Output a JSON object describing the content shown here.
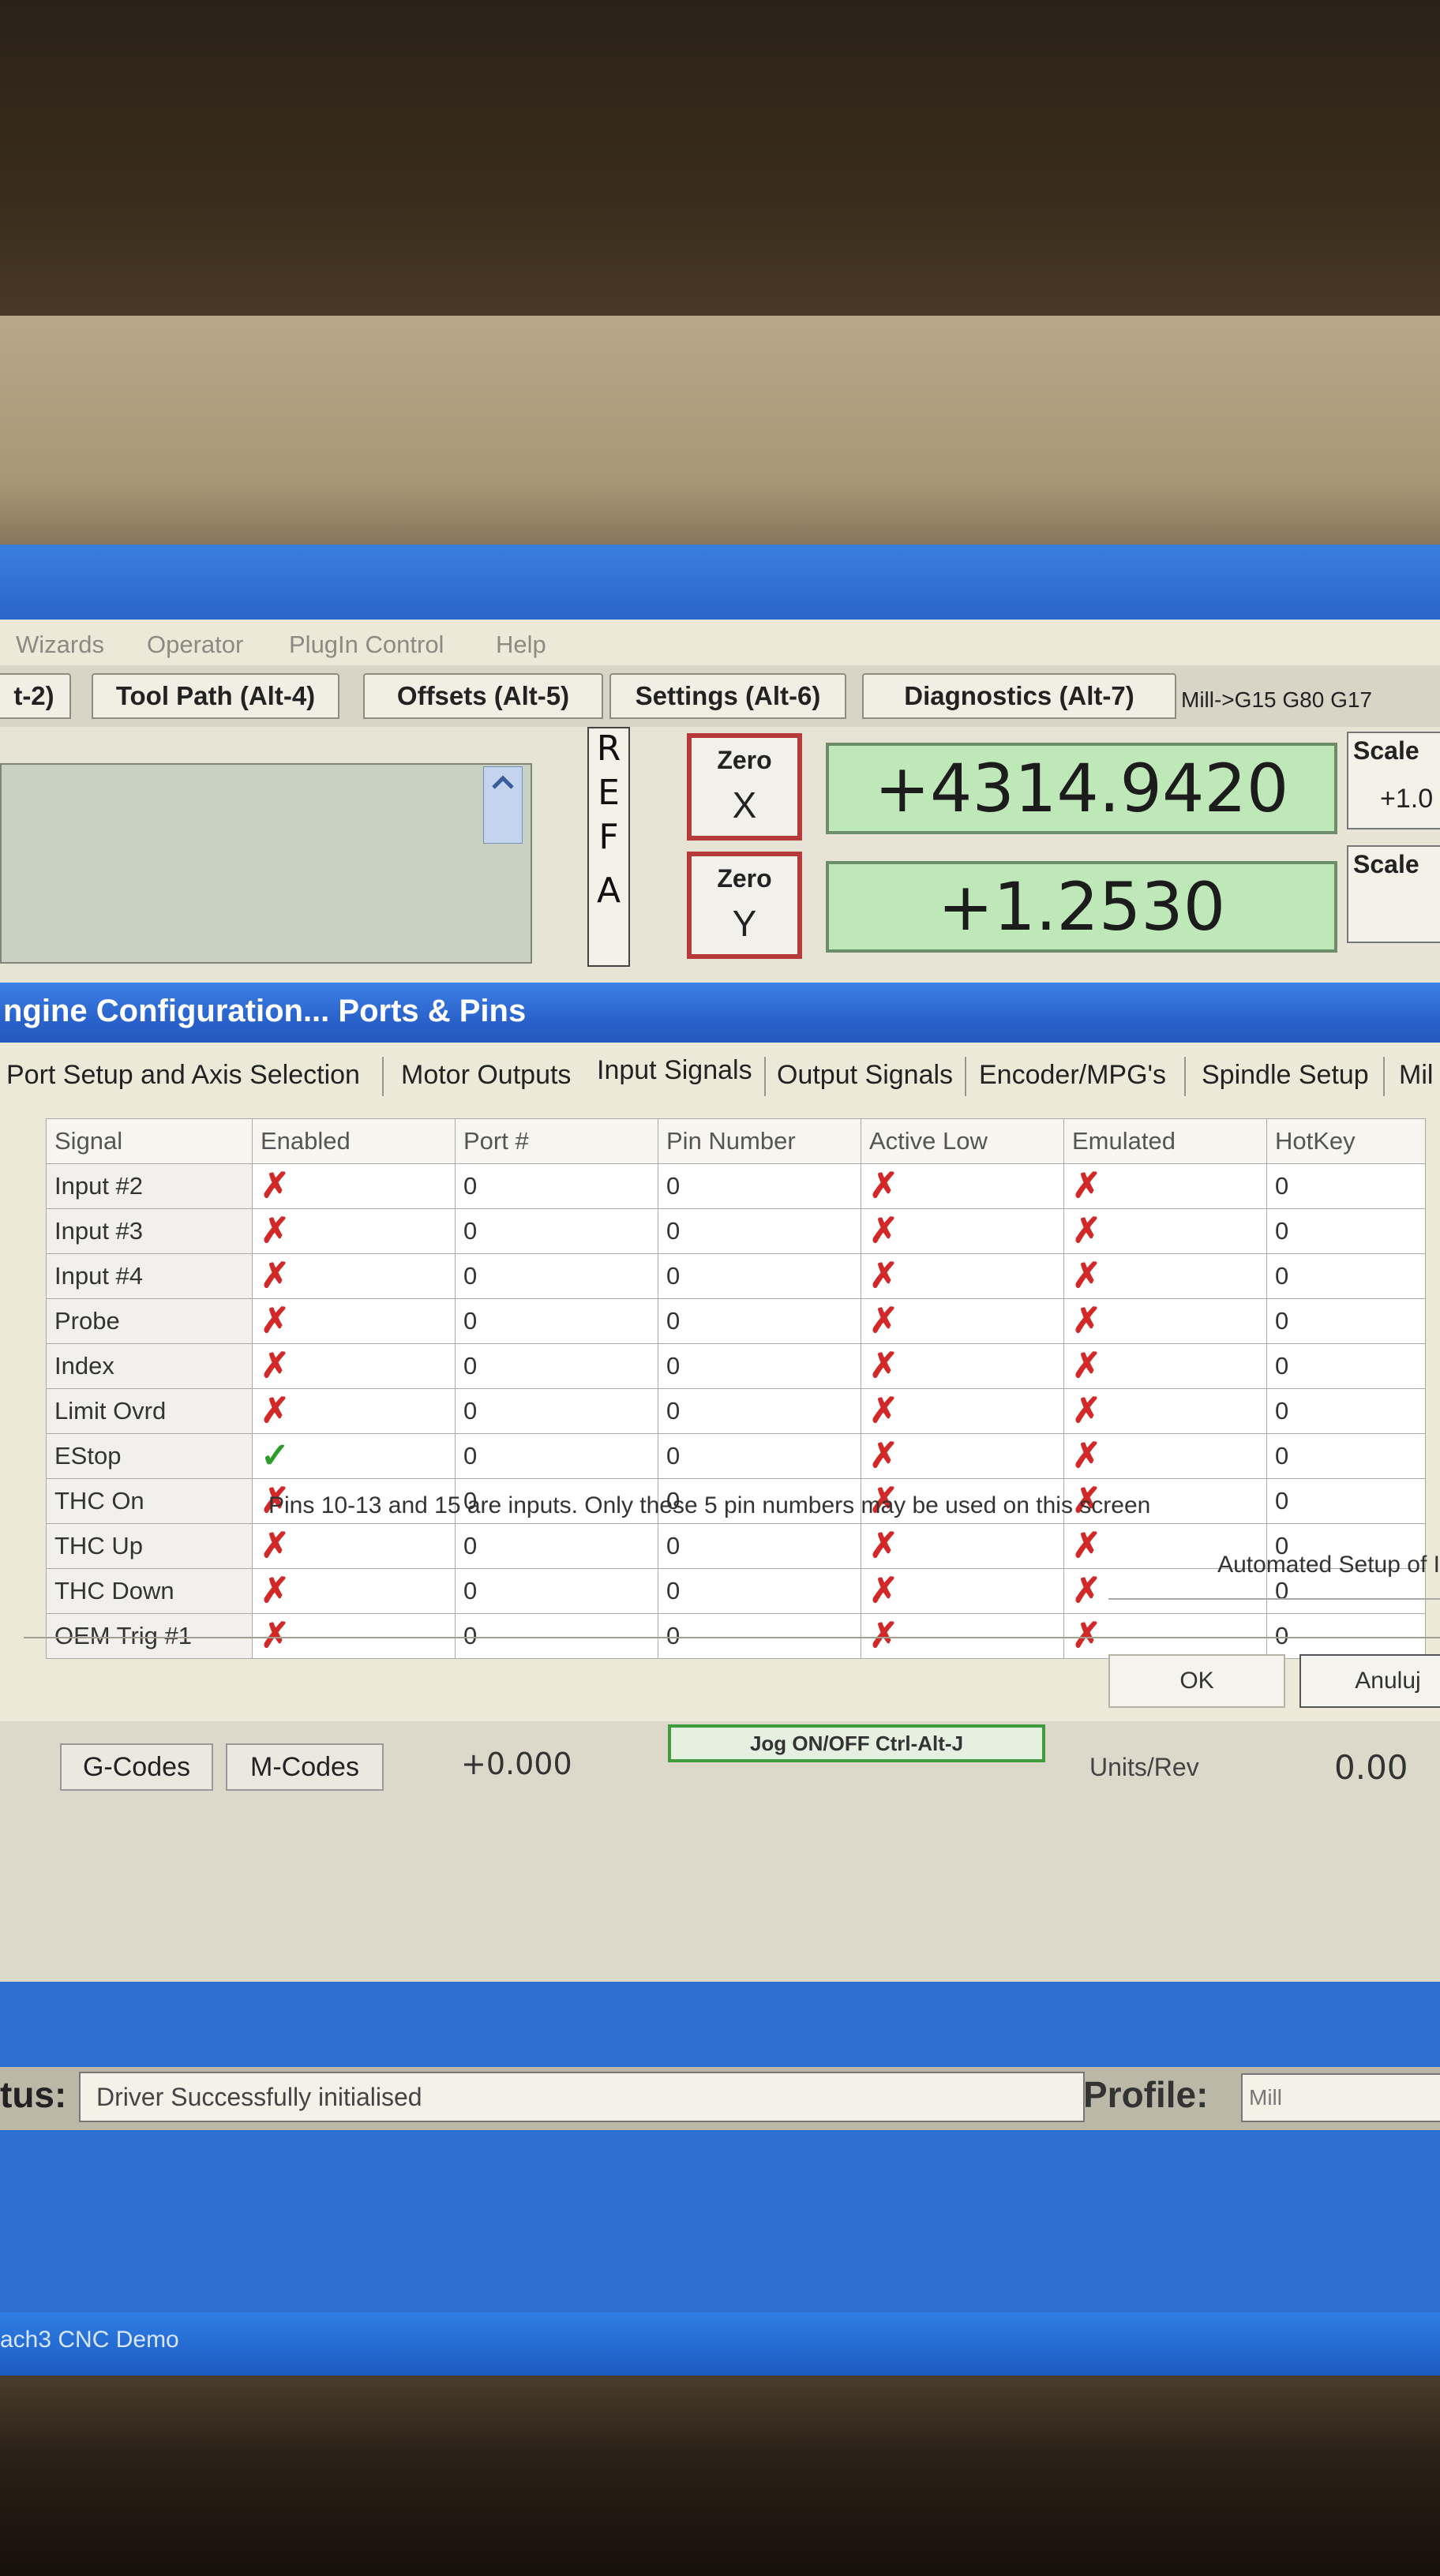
{
  "menu": [
    "Wizards",
    "Operator",
    "PlugIn Control",
    "Help"
  ],
  "main_tabs": [
    "t-2)",
    "Tool Path (Alt-4)",
    "Offsets (Alt-5)",
    "Settings (Alt-6)",
    "Diagnostics (Alt-7)"
  ],
  "gcode_status": "Mill->G15  G80 G17",
  "ref_letters": [
    "R",
    "E",
    "F",
    "A"
  ],
  "zero_x": {
    "top": "Zero",
    "bottom": "X"
  },
  "zero_y": {
    "top": "Zero",
    "bottom": "Y"
  },
  "dro_x": "+4314.9420",
  "dro_y": "+1.2530",
  "scale_1": {
    "label": "Scale",
    "value": "+1.0"
  },
  "scale_2": {
    "label": "Scale"
  },
  "dialog": {
    "title": "ngine Configuration... Ports & Pins",
    "tabs": [
      "Port Setup and Axis Selection",
      "Motor Outputs",
      "Input Signals",
      "Output Signals",
      "Encoder/MPG's",
      "Spindle Setup",
      "Mil"
    ],
    "columns": [
      "Signal",
      "Enabled",
      "Port #",
      "Pin Number",
      "Active Low",
      "Emulated",
      "HotKey"
    ],
    "rows": [
      {
        "signal": "Input #2",
        "enabled": "x",
        "port": "0",
        "pin": "0",
        "active_low": "x",
        "emulated": "x",
        "hotkey": "0"
      },
      {
        "signal": "Input #3",
        "enabled": "x",
        "port": "0",
        "pin": "0",
        "active_low": "x",
        "emulated": "x",
        "hotkey": "0"
      },
      {
        "signal": "Input #4",
        "enabled": "x",
        "port": "0",
        "pin": "0",
        "active_low": "x",
        "emulated": "x",
        "hotkey": "0"
      },
      {
        "signal": "Probe",
        "enabled": "x",
        "port": "0",
        "pin": "0",
        "active_low": "x",
        "emulated": "x",
        "hotkey": "0"
      },
      {
        "signal": "Index",
        "enabled": "x",
        "port": "0",
        "pin": "0",
        "active_low": "x",
        "emulated": "x",
        "hotkey": "0"
      },
      {
        "signal": "Limit Ovrd",
        "enabled": "x",
        "port": "0",
        "pin": "0",
        "active_low": "x",
        "emulated": "x",
        "hotkey": "0"
      },
      {
        "signal": "EStop",
        "enabled": "check",
        "port": "0",
        "pin": "0",
        "active_low": "x",
        "emulated": "x",
        "hotkey": "0"
      },
      {
        "signal": "THC On",
        "enabled": "x",
        "port": "0",
        "pin": "0",
        "active_low": "x",
        "emulated": "x",
        "hotkey": "0"
      },
      {
        "signal": "THC Up",
        "enabled": "x",
        "port": "0",
        "pin": "0",
        "active_low": "x",
        "emulated": "x",
        "hotkey": "0"
      },
      {
        "signal": "THC Down",
        "enabled": "x",
        "port": "0",
        "pin": "0",
        "active_low": "x",
        "emulated": "x",
        "hotkey": "0"
      },
      {
        "signal": "OEM Trig #1",
        "enabled": "x",
        "port": "0",
        "pin": "0",
        "active_low": "x",
        "emulated": "x",
        "hotkey": "0"
      }
    ],
    "note": "Pins 10-13 and 15 are inputs. Only these 5 pin numbers may be used on this screen",
    "automated_setup": "Automated Setup of Inpu",
    "ok": "OK",
    "cancel": "Anuluj"
  },
  "lower": {
    "gcodes": "G-Codes",
    "mcodes": "M-Codes",
    "value": "+0.000",
    "jog": "Jog ON/OFF Ctrl-Alt-J",
    "units_rev": "Units/Rev",
    "units_rev_value": "0.00"
  },
  "status": {
    "label": "tus:",
    "text": "Driver Successfully initialised",
    "profile_label": "Profile:",
    "profile": "Mill"
  },
  "taskbar": "ach3 CNC Demo",
  "icons": {
    "cross": "✗",
    "check": "✓"
  }
}
